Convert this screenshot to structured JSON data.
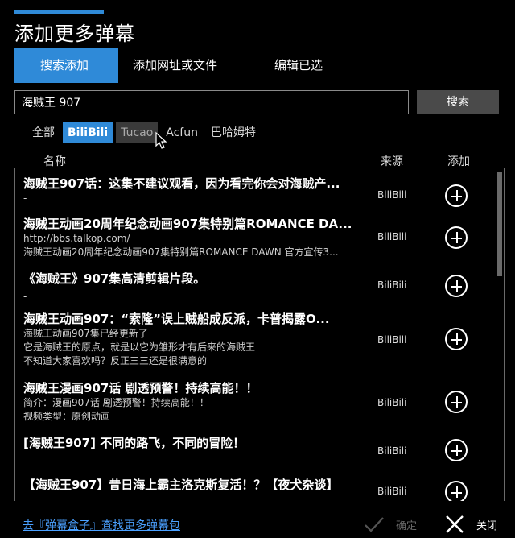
{
  "window": {
    "title": "添加更多弹幕"
  },
  "tabs": [
    {
      "label": "搜索添加",
      "active": true
    },
    {
      "label": "添加网址或文件",
      "active": false
    },
    {
      "label": "编辑已选",
      "active": false
    }
  ],
  "search": {
    "value": "海贼王 907",
    "button_label": "搜索"
  },
  "filters": [
    {
      "label": "全部",
      "state": "normal"
    },
    {
      "label": "BiliBili",
      "state": "active"
    },
    {
      "label": "Tucao",
      "state": "hover"
    },
    {
      "label": "Acfun",
      "state": "normal"
    },
    {
      "label": "巴哈姆特",
      "state": "normal"
    }
  ],
  "columns": {
    "name": "名称",
    "source": "来源",
    "add": "添加"
  },
  "results": [
    {
      "title": "海贼王907话：这集不建议观看，因为看完你会对海贼产...",
      "desc": [
        "-"
      ],
      "source": "BiliBili"
    },
    {
      "title": "海贼王动画20周年纪念动画907集特别篇ROMANCE DA...",
      "desc": [
        "http://bbs.talkop.com/",
        "海贼王动画20周年纪念动画907集特别篇ROMANCE DAWN 官方宣传3..."
      ],
      "source": "BiliBili"
    },
    {
      "title": "《海贼王》907集高清剪辑片段。",
      "desc": [
        "-"
      ],
      "source": "BiliBili"
    },
    {
      "title": "海贼王动画907：“索隆”误上贼船成反派，卡普揭露O...",
      "desc": [
        "海贼王动画907集已经更新了",
        "它是海贼王的原点，就是以它为雏形才有后来的海贼王",
        "不知道大家喜欢吗？反正三三还是很满意的"
      ],
      "source": "BiliBili"
    },
    {
      "title": "海贼王漫画907话 剧透预警！持续高能！！",
      "desc": [
        "简介：漫画907话 剧透预警！持续高能！！",
        "视频类型：原创动画"
      ],
      "source": "BiliBili"
    },
    {
      "title": "[海贼王907] 不同的路飞，不同的冒险！",
      "desc": [
        "-"
      ],
      "source": "BiliBili"
    },
    {
      "title": "【海贼王907】昔日海上霸主洛克斯复活！？【夜犬杂谈】",
      "desc": [],
      "source": "BiliBili"
    }
  ],
  "footer": {
    "link": "去『弹幕盒子』查找更多弹幕包",
    "confirm_label": "确定",
    "close_label": "关闭"
  },
  "colors": {
    "accent": "#2f8ad8",
    "link": "#4aa0ff",
    "background": "#000000"
  },
  "icons": [
    "plus-circle-icon",
    "check-icon",
    "close-icon",
    "mouse-pointer-icon"
  ]
}
